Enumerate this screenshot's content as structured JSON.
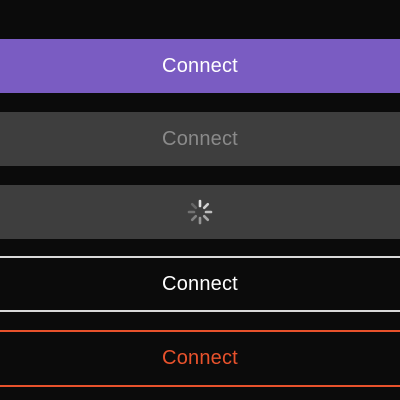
{
  "buttons": {
    "primary": {
      "label": "Connect"
    },
    "disabled": {
      "label": "Connect"
    },
    "loading": {
      "icon": "spinner-icon"
    },
    "outline": {
      "label": "Connect"
    },
    "danger": {
      "label": "Connect"
    }
  },
  "colors": {
    "background": "#0b0b0b",
    "primary": "#7a5cc2",
    "disabled_bg": "#3e3e3e",
    "disabled_text": "#8a8a8a",
    "outline_border": "#d9d9d9",
    "danger": "#e8522c"
  }
}
